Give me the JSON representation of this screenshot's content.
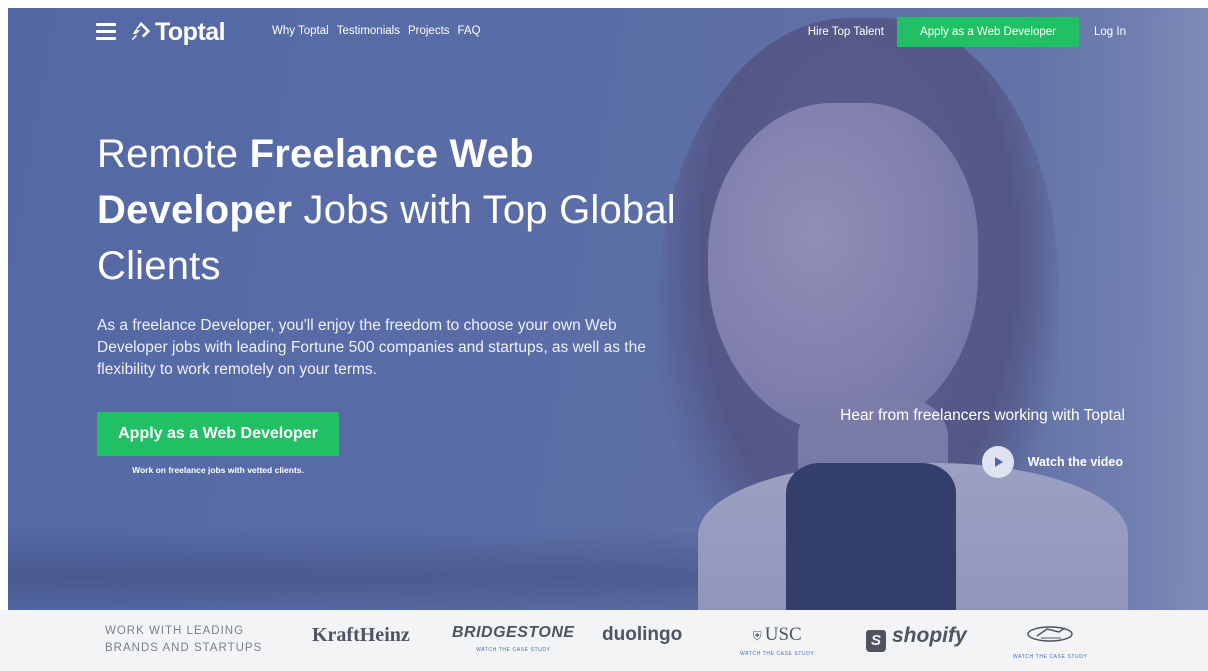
{
  "nav": {
    "logo_text": "Toptal",
    "links": [
      "Why Toptal",
      "Testimonials",
      "Projects",
      "FAQ"
    ],
    "hire_label": "Hire Top Talent",
    "apply_label": "Apply as a Web Developer",
    "login_label": "Log In"
  },
  "hero": {
    "title_part1": "Remote ",
    "title_bold1": "Freelance Web Developer",
    "title_part2": " Jobs with Top Global Clients",
    "subtitle": "As a freelance Developer, you'll enjoy the freedom to choose your own Web Developer jobs with leading Fortune 500 companies and startups, as well as the flexibility to work remotely on your terms.",
    "cta_label": "Apply as a Web Developer",
    "cta_note": "Work on freelance jobs with vetted clients.",
    "video_heading": "Hear from freelancers working with Toptal",
    "video_label": "Watch the video"
  },
  "brands": {
    "title": "WORK WITH LEADING BRANDS AND STARTUPS",
    "case_study_label": "WATCH THE CASE STUDY",
    "items": [
      {
        "name": "KraftHeinz",
        "case_study": false
      },
      {
        "name": "BRIDGESTONE",
        "case_study": true
      },
      {
        "name": "duolingo",
        "case_study": false
      },
      {
        "name": "USC",
        "case_study": true
      },
      {
        "name": "shopify",
        "case_study": false
      },
      {
        "name": "Cavaliers",
        "case_study": true
      }
    ]
  },
  "colors": {
    "accent_green": "#21c065",
    "hero_overlay": "#485ca0",
    "brand_strip_bg": "#f3f4f6"
  }
}
